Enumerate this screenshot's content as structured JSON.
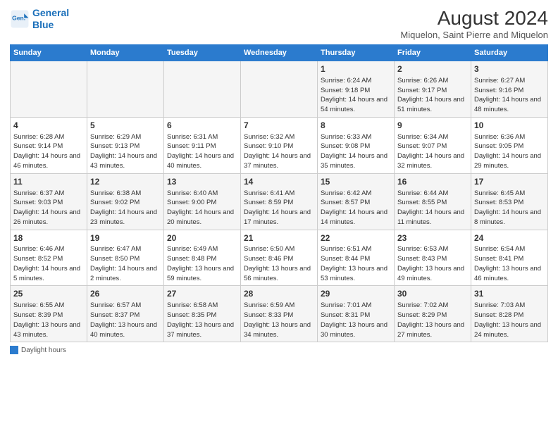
{
  "logo": {
    "line1": "General",
    "line2": "Blue"
  },
  "title": "August 2024",
  "subtitle": "Miquelon, Saint Pierre and Miquelon",
  "days_of_week": [
    "Sunday",
    "Monday",
    "Tuesday",
    "Wednesday",
    "Thursday",
    "Friday",
    "Saturday"
  ],
  "legend": "Daylight hours",
  "weeks": [
    [
      {
        "day": "",
        "info": ""
      },
      {
        "day": "",
        "info": ""
      },
      {
        "day": "",
        "info": ""
      },
      {
        "day": "",
        "info": ""
      },
      {
        "day": "1",
        "info": "Sunrise: 6:24 AM\nSunset: 9:18 PM\nDaylight: 14 hours\nand 54 minutes."
      },
      {
        "day": "2",
        "info": "Sunrise: 6:26 AM\nSunset: 9:17 PM\nDaylight: 14 hours\nand 51 minutes."
      },
      {
        "day": "3",
        "info": "Sunrise: 6:27 AM\nSunset: 9:16 PM\nDaylight: 14 hours\nand 48 minutes."
      }
    ],
    [
      {
        "day": "4",
        "info": "Sunrise: 6:28 AM\nSunset: 9:14 PM\nDaylight: 14 hours\nand 46 minutes."
      },
      {
        "day": "5",
        "info": "Sunrise: 6:29 AM\nSunset: 9:13 PM\nDaylight: 14 hours\nand 43 minutes."
      },
      {
        "day": "6",
        "info": "Sunrise: 6:31 AM\nSunset: 9:11 PM\nDaylight: 14 hours\nand 40 minutes."
      },
      {
        "day": "7",
        "info": "Sunrise: 6:32 AM\nSunset: 9:10 PM\nDaylight: 14 hours\nand 37 minutes."
      },
      {
        "day": "8",
        "info": "Sunrise: 6:33 AM\nSunset: 9:08 PM\nDaylight: 14 hours\nand 35 minutes."
      },
      {
        "day": "9",
        "info": "Sunrise: 6:34 AM\nSunset: 9:07 PM\nDaylight: 14 hours\nand 32 minutes."
      },
      {
        "day": "10",
        "info": "Sunrise: 6:36 AM\nSunset: 9:05 PM\nDaylight: 14 hours\nand 29 minutes."
      }
    ],
    [
      {
        "day": "11",
        "info": "Sunrise: 6:37 AM\nSunset: 9:03 PM\nDaylight: 14 hours\nand 26 minutes."
      },
      {
        "day": "12",
        "info": "Sunrise: 6:38 AM\nSunset: 9:02 PM\nDaylight: 14 hours\nand 23 minutes."
      },
      {
        "day": "13",
        "info": "Sunrise: 6:40 AM\nSunset: 9:00 PM\nDaylight: 14 hours\nand 20 minutes."
      },
      {
        "day": "14",
        "info": "Sunrise: 6:41 AM\nSunset: 8:59 PM\nDaylight: 14 hours\nand 17 minutes."
      },
      {
        "day": "15",
        "info": "Sunrise: 6:42 AM\nSunset: 8:57 PM\nDaylight: 14 hours\nand 14 minutes."
      },
      {
        "day": "16",
        "info": "Sunrise: 6:44 AM\nSunset: 8:55 PM\nDaylight: 14 hours\nand 11 minutes."
      },
      {
        "day": "17",
        "info": "Sunrise: 6:45 AM\nSunset: 8:53 PM\nDaylight: 14 hours\nand 8 minutes."
      }
    ],
    [
      {
        "day": "18",
        "info": "Sunrise: 6:46 AM\nSunset: 8:52 PM\nDaylight: 14 hours\nand 5 minutes."
      },
      {
        "day": "19",
        "info": "Sunrise: 6:47 AM\nSunset: 8:50 PM\nDaylight: 14 hours\nand 2 minutes."
      },
      {
        "day": "20",
        "info": "Sunrise: 6:49 AM\nSunset: 8:48 PM\nDaylight: 13 hours\nand 59 minutes."
      },
      {
        "day": "21",
        "info": "Sunrise: 6:50 AM\nSunset: 8:46 PM\nDaylight: 13 hours\nand 56 minutes."
      },
      {
        "day": "22",
        "info": "Sunrise: 6:51 AM\nSunset: 8:44 PM\nDaylight: 13 hours\nand 53 minutes."
      },
      {
        "day": "23",
        "info": "Sunrise: 6:53 AM\nSunset: 8:43 PM\nDaylight: 13 hours\nand 49 minutes."
      },
      {
        "day": "24",
        "info": "Sunrise: 6:54 AM\nSunset: 8:41 PM\nDaylight: 13 hours\nand 46 minutes."
      }
    ],
    [
      {
        "day": "25",
        "info": "Sunrise: 6:55 AM\nSunset: 8:39 PM\nDaylight: 13 hours\nand 43 minutes."
      },
      {
        "day": "26",
        "info": "Sunrise: 6:57 AM\nSunset: 8:37 PM\nDaylight: 13 hours\nand 40 minutes."
      },
      {
        "day": "27",
        "info": "Sunrise: 6:58 AM\nSunset: 8:35 PM\nDaylight: 13 hours\nand 37 minutes."
      },
      {
        "day": "28",
        "info": "Sunrise: 6:59 AM\nSunset: 8:33 PM\nDaylight: 13 hours\nand 34 minutes."
      },
      {
        "day": "29",
        "info": "Sunrise: 7:01 AM\nSunset: 8:31 PM\nDaylight: 13 hours\nand 30 minutes."
      },
      {
        "day": "30",
        "info": "Sunrise: 7:02 AM\nSunset: 8:29 PM\nDaylight: 13 hours\nand 27 minutes."
      },
      {
        "day": "31",
        "info": "Sunrise: 7:03 AM\nSunset: 8:28 PM\nDaylight: 13 hours\nand 24 minutes."
      }
    ]
  ]
}
